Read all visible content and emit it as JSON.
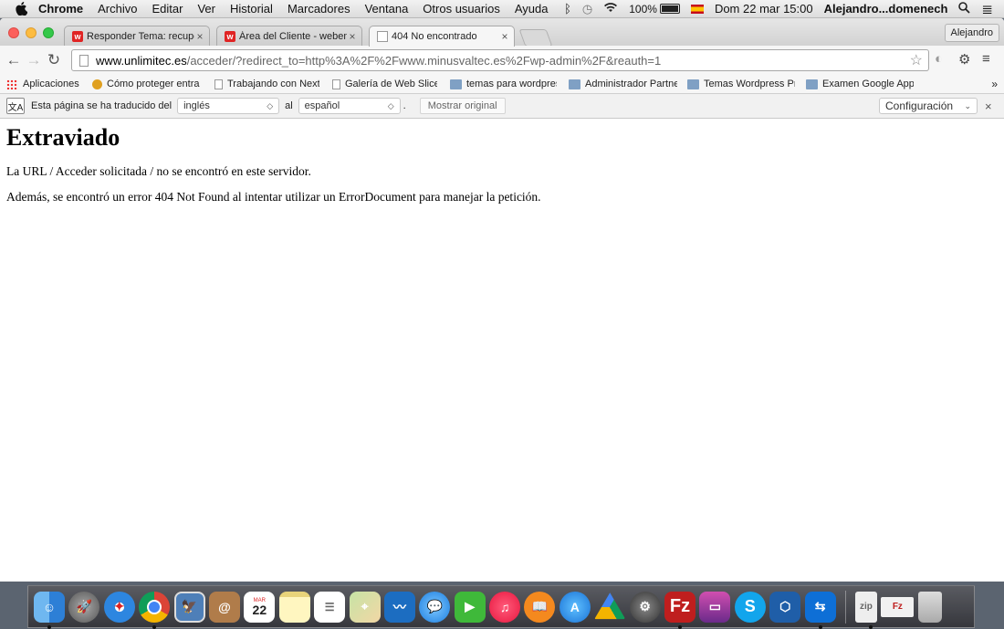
{
  "menubar": {
    "app": "Chrome",
    "items": [
      "Archivo",
      "Editar",
      "Ver",
      "Historial",
      "Marcadores",
      "Ventana",
      "Otros usuarios",
      "Ayuda"
    ],
    "battery": "100%",
    "datetime": "Dom 22 mar  15:00",
    "user": "Alejandro...domenech"
  },
  "tabs": [
    {
      "title": "Responder Tema: recupera",
      "icon": "webempresa-icon",
      "active": false
    },
    {
      "title": "Área del Cliente - webemp",
      "icon": "webempresa-icon",
      "active": false
    },
    {
      "title": "404 No encontrado",
      "icon": "page-icon",
      "active": true
    }
  ],
  "profile": "Alejandro",
  "address": {
    "host": "www.unlimitec.es",
    "path": "/acceder/?redirect_to=http%3A%2F%2Fwww.minusvaltec.es%2Fwp-admin%2F&reauth=1"
  },
  "bookmarks": [
    {
      "label": "Aplicaciones",
      "icon": "apps-grid-icon"
    },
    {
      "label": "Cómo proteger entra",
      "icon": "coin-icon"
    },
    {
      "label": "Trabajando con Next",
      "icon": "page-icon"
    },
    {
      "label": "Galería de Web Slice",
      "icon": "page-icon"
    },
    {
      "label": "temas para wordpres",
      "icon": "folder-icon"
    },
    {
      "label": "Administrador Partne",
      "icon": "folder-icon"
    },
    {
      "label": "Temas Wordpress Pr",
      "icon": "folder-icon"
    },
    {
      "label": "Examen Google App",
      "icon": "folder-icon"
    }
  ],
  "bookmarks_more": "»",
  "translate": {
    "prefix": "Esta página se ha traducido del",
    "from_lang": "inglés",
    "connector": "al",
    "to_lang": "español",
    "period": ".",
    "show_original": "Mostrar original",
    "settings": "Configuración",
    "close": "×"
  },
  "page": {
    "heading": "Extraviado",
    "line1": "La URL / Acceder solicitada / no se encontró en este servidor.",
    "line2": "Además, se encontró un error 404 Not Found al intentar utilizar un ErrorDocument para manejar la petición."
  },
  "dock": {
    "calendar_month": "MAR",
    "calendar_day": "22",
    "apps": [
      "finder",
      "launchpad",
      "safari",
      "chrome",
      "preview",
      "contacts",
      "calendar",
      "notes",
      "reminders",
      "maps",
      "openoffice",
      "messages",
      "facetime",
      "itunes",
      "ibooks",
      "app-store",
      "google-drive",
      "system-preferences",
      "filezilla",
      "photo-booth",
      "skype",
      "virtualbox",
      "teamviewer",
      "archive-utility",
      "filezilla-doc",
      "trash"
    ]
  }
}
